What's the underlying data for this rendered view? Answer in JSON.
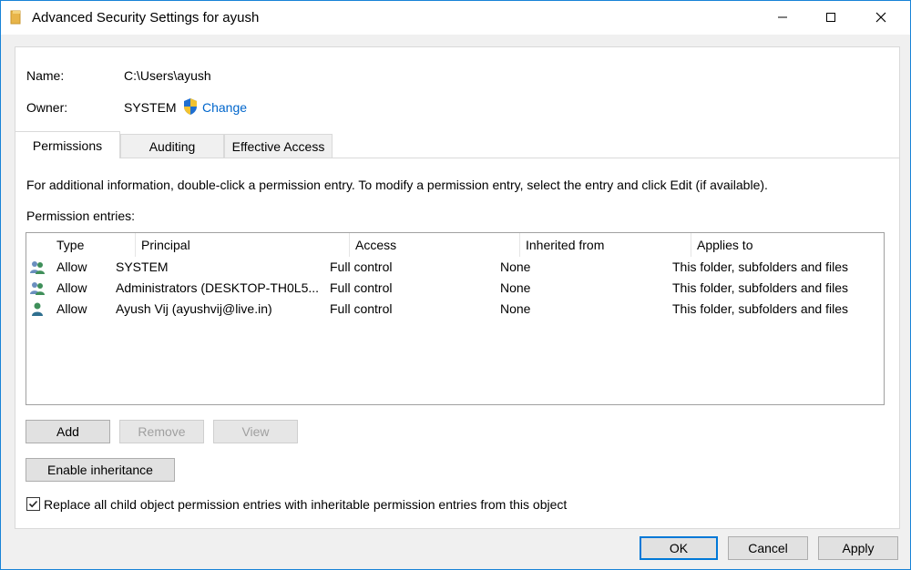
{
  "window": {
    "title": "Advanced Security Settings for ayush"
  },
  "info": {
    "name_label": "Name:",
    "name_value": "C:\\Users\\ayush",
    "owner_label": "Owner:",
    "owner_value": "SYSTEM",
    "change_link": "Change"
  },
  "tabs": [
    {
      "label": "Permissions",
      "active": true
    },
    {
      "label": "Auditing",
      "active": false
    },
    {
      "label": "Effective Access",
      "active": false
    }
  ],
  "permissions": {
    "instructions": "For additional information, double-click a permission entry. To modify a permission entry, select the entry and click Edit (if available).",
    "entries_label": "Permission entries:",
    "columns": [
      "Type",
      "Principal",
      "Access",
      "Inherited from",
      "Applies to"
    ],
    "rows": [
      {
        "icon": "group-users-icon",
        "type": "Allow",
        "principal": "SYSTEM",
        "access": "Full control",
        "inherited": "None",
        "applies": "This folder, subfolders and files"
      },
      {
        "icon": "group-users-icon",
        "type": "Allow",
        "principal": "Administrators (DESKTOP-TH0L5...",
        "access": "Full control",
        "inherited": "None",
        "applies": "This folder, subfolders and files"
      },
      {
        "icon": "single-user-icon",
        "type": "Allow",
        "principal": "Ayush Vij (ayushvij@live.in)",
        "access": "Full control",
        "inherited": "None",
        "applies": "This folder, subfolders and files"
      }
    ],
    "add_label": "Add",
    "remove_label": "Remove",
    "view_label": "View",
    "enable_inheritance_label": "Enable inheritance",
    "replace_checkbox_label": "Replace all child object permission entries with inheritable permission entries from this object",
    "replace_checked": true
  },
  "footer": {
    "ok_label": "OK",
    "cancel_label": "Cancel",
    "apply_label": "Apply"
  }
}
